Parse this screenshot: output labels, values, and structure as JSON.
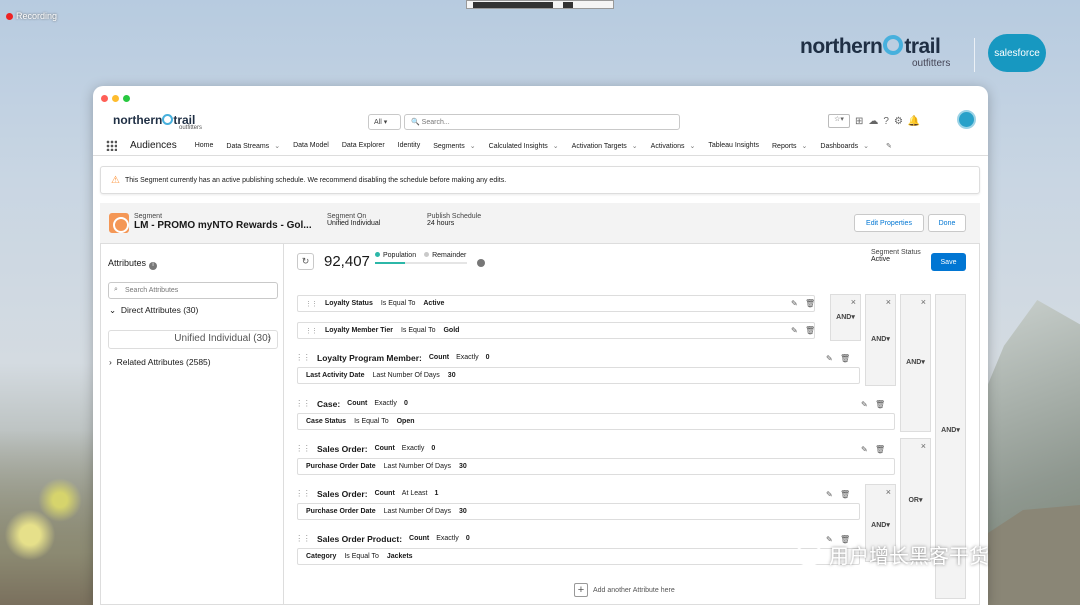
{
  "recording": {
    "label": "Recording"
  },
  "brand": {
    "name_left": "northern",
    "name_right": "trail",
    "sub": "outfitters",
    "partner": "salesforce"
  },
  "header": {
    "logo_left": "northern",
    "logo_right": "trail",
    "logo_sub": "outfitters",
    "search_scope": "All",
    "search_placeholder": "Search..."
  },
  "nav": {
    "app_name": "Audiences",
    "items": [
      {
        "label": "Home",
        "dropdown": false
      },
      {
        "label": "Data Streams",
        "dropdown": true
      },
      {
        "label": "Data Model",
        "dropdown": false
      },
      {
        "label": "Data Explorer",
        "dropdown": false
      },
      {
        "label": "Identity",
        "dropdown": false
      },
      {
        "label": "Segments",
        "dropdown": true
      },
      {
        "label": "Calculated Insights",
        "dropdown": true
      },
      {
        "label": "Activation Targets",
        "dropdown": true
      },
      {
        "label": "Activations",
        "dropdown": true
      },
      {
        "label": "Tableau Insights",
        "dropdown": false
      },
      {
        "label": "Reports",
        "dropdown": true
      },
      {
        "label": "Dashboards",
        "dropdown": true
      }
    ]
  },
  "warning": {
    "text": "This Segment currently has an active publishing schedule. We recommend disabling the schedule before making any edits."
  },
  "segment": {
    "label": "Segment",
    "name": "LM - PROMO myNTO Rewards - Gol...",
    "segment_on_label": "Segment On",
    "segment_on_value": "Unified Individual",
    "schedule_label": "Publish Schedule",
    "schedule_value": "24 hours",
    "edit_button": "Edit Properties",
    "done_button": "Done"
  },
  "attributes_panel": {
    "title": "Attributes",
    "search_placeholder": "Search Attributes",
    "direct": "Direct Attributes (30)",
    "unified": "Unified Individual (30)",
    "related": "Related Attributes (2585)"
  },
  "canvas": {
    "population_count": "92,407",
    "population_label": "Population",
    "remainder_label": "Remainder",
    "status_label": "Segment Status",
    "status_value": "Active",
    "save_button": "Save",
    "add_attribute": "Add another Attribute here",
    "and_label": "AND▾",
    "or_label": "OR▾"
  },
  "rules": {
    "r1": {
      "field": "Loyalty Status",
      "op": "Is Equal To",
      "value": "Active"
    },
    "r2": {
      "field": "Loyalty Member Tier",
      "op": "Is Equal To",
      "value": "Gold"
    },
    "r3": {
      "name": "Loyalty Program Member:",
      "agg": "Count",
      "cmp": "Exactly",
      "num": "0",
      "cond_field": "Last Activity Date",
      "cond_op": "Last Number Of Days",
      "cond_value": "30"
    },
    "r4": {
      "name": "Case:",
      "agg": "Count",
      "cmp": "Exactly",
      "num": "0",
      "cond_field": "Case Status",
      "cond_op": "Is Equal To",
      "cond_value": "Open"
    },
    "r5": {
      "name": "Sales Order:",
      "agg": "Count",
      "cmp": "Exactly",
      "num": "0",
      "cond_field": "Purchase Order Date",
      "cond_op": "Last Number Of Days",
      "cond_value": "30"
    },
    "r6": {
      "name": "Sales Order:",
      "agg": "Count",
      "cmp": "At Least",
      "num": "1",
      "cond_field": "Purchase Order Date",
      "cond_op": "Last Number Of Days",
      "cond_value": "30"
    },
    "r7": {
      "name": "Sales Order Product:",
      "agg": "Count",
      "cmp": "Exactly",
      "num": "0",
      "cond_field": "Category",
      "cond_op": "Is Equal To",
      "cond_value": "Jackets"
    }
  },
  "watermark": {
    "text": "用户增长黑客干货"
  }
}
